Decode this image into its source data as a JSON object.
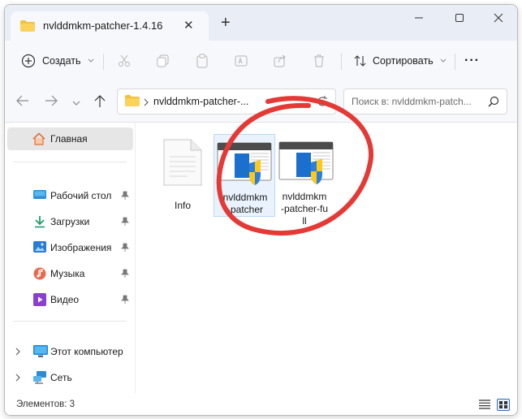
{
  "window": {
    "tab_title": "nvlddmkm-patcher-1.4.16",
    "tab_close": "✕",
    "new_tab": "+",
    "controls": {
      "minimize": "minimize-icon",
      "maximize": "maximize-icon",
      "close": "close-icon"
    }
  },
  "toolbar": {
    "create_label": "Создать",
    "sort_label": "Сортировать",
    "more_label": "···",
    "icons": [
      "cut-icon",
      "copy-icon",
      "paste-icon",
      "rename-icon",
      "share-icon",
      "delete-icon"
    ]
  },
  "address": {
    "path_label": "nvlddmkm-patcher-...",
    "search_placeholder": "Поиск в: nvlddmkm-patch..."
  },
  "sidebar": {
    "home": "Главная",
    "pinned": [
      {
        "label": "Рабочий стол",
        "icon": "desktop-icon"
      },
      {
        "label": "Загрузки",
        "icon": "download-icon"
      },
      {
        "label": "Изображения",
        "icon": "pictures-icon"
      },
      {
        "label": "Музыка",
        "icon": "music-icon"
      },
      {
        "label": "Видео",
        "icon": "video-icon"
      }
    ],
    "this_pc": "Этот компьютер",
    "network": "Сеть"
  },
  "files": [
    {
      "name": "Info",
      "type": "text-file-icon"
    },
    {
      "name": "nvlddmkm\n-patcher",
      "type": "exe-shield-icon",
      "selected": true
    },
    {
      "name": "nvlddmkm\n-patcher-fu\nll",
      "type": "exe-shield-icon"
    }
  ],
  "status": {
    "items_text": "Элементов: 3"
  },
  "colors": {
    "accent": "#0067c0",
    "annotation": "#e53935",
    "titlebar": "#e9eef6"
  }
}
